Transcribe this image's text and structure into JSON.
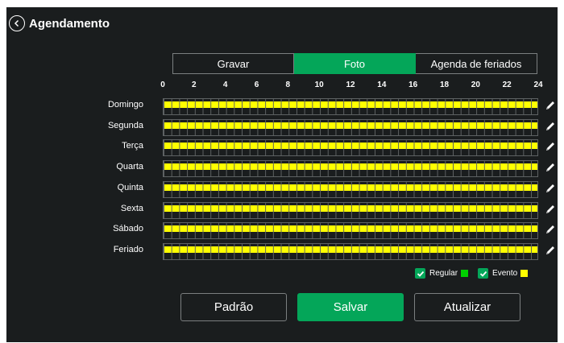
{
  "header": {
    "title": "Agendamento"
  },
  "tabs": [
    {
      "label": "Gravar",
      "active": false
    },
    {
      "label": "Foto",
      "active": true
    },
    {
      "label": "Agenda de feriados",
      "active": false
    }
  ],
  "hours": [
    "0",
    "2",
    "4",
    "6",
    "8",
    "10",
    "12",
    "14",
    "16",
    "18",
    "20",
    "22",
    "24"
  ],
  "days": [
    {
      "label": "Domingo",
      "event_coverage": 1.0
    },
    {
      "label": "Segunda",
      "event_coverage": 1.0
    },
    {
      "label": "Terça",
      "event_coverage": 1.0
    },
    {
      "label": "Quarta",
      "event_coverage": 1.0
    },
    {
      "label": "Quinta",
      "event_coverage": 1.0
    },
    {
      "label": "Sexta",
      "event_coverage": 1.0
    },
    {
      "label": "Sábado",
      "event_coverage": 1.0
    },
    {
      "label": "Feriado",
      "event_coverage": 1.0
    }
  ],
  "legend": {
    "regular_label": "Regular",
    "regular_color": "#00d000",
    "regular_checked": true,
    "event_label": "Evento",
    "event_color": "#ffff00",
    "event_checked": true
  },
  "buttons": {
    "default_label": "Padrão",
    "save_label": "Salvar",
    "refresh_label": "Atualizar"
  },
  "colors": {
    "accent": "#04a659",
    "background": "#1a1d1e",
    "event_bar": "#ffff00"
  }
}
